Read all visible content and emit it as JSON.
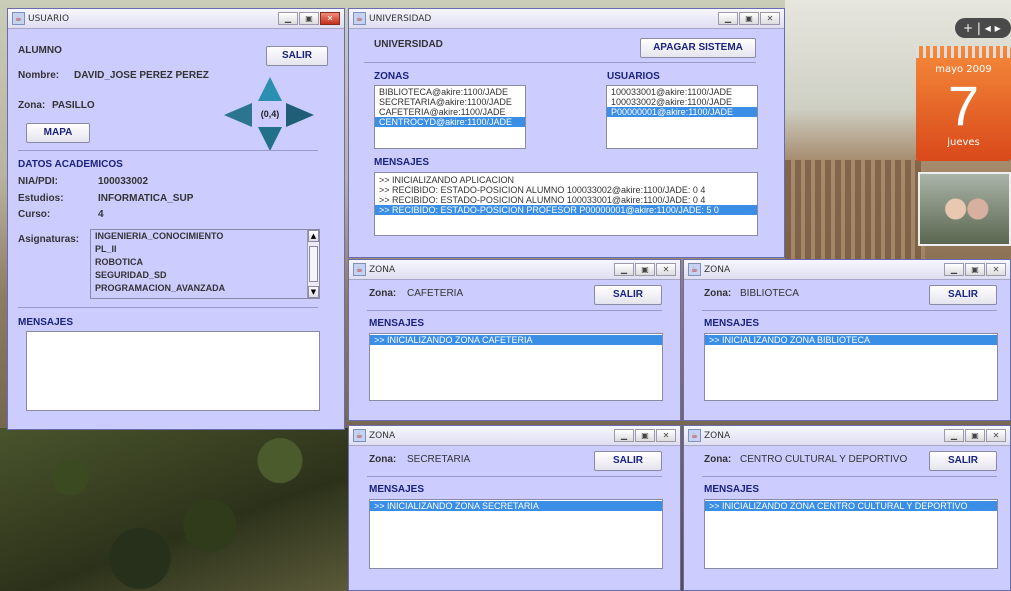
{
  "desktop": {
    "gadget_ctrl": "+ | ◂ ▸",
    "calendar": {
      "month": "mayo 2009",
      "day": "7",
      "weekday": "jueves"
    }
  },
  "usuario": {
    "title": "USUARIO",
    "alumno_label": "ALUMNO",
    "salir": "SALIR",
    "nombre_label": "Nombre:",
    "nombre_value": "DAVID_JOSE PEREZ PEREZ",
    "zona_label": "Zona:",
    "zona_value": "PASILLO",
    "coord": "(0,4)",
    "mapa": "MAPA",
    "datos_title": "DATOS ACADEMICOS",
    "nia_label": "NIA/PDI:",
    "nia_value": "100033002",
    "estudios_label": "Estudios:",
    "estudios_value": "INFORMATICA_SUP",
    "curso_label": "Curso:",
    "curso_value": "4",
    "asignaturas_label": "Asignaturas:",
    "asignaturas": [
      "INGENIERIA_CONOCIMIENTO",
      "PL_II",
      "ROBOTICA",
      "SEGURIDAD_SD",
      "PROGRAMACION_AVANZADA"
    ],
    "mensajes_label": "MENSAJES"
  },
  "universidad": {
    "title": "UNIVERSIDAD",
    "heading": "UNIVERSIDAD",
    "apagar": "APAGAR SISTEMA",
    "zonas_label": "ZONAS",
    "zonas": [
      "BIBLIOTECA@akire:1100/JADE",
      "SECRETARIA@akire:1100/JADE",
      "CAFETERIA@akire:1100/JADE",
      "CENTROCYD@akire:1100/JADE"
    ],
    "usuarios_label": "USUARIOS",
    "usuarios": [
      "100033001@akire:1100/JADE",
      "100033002@akire:1100/JADE",
      "P00000001@akire:1100/JADE"
    ],
    "mensajes_label": "MENSAJES",
    "mensajes": [
      ">> INICIALIZANDO APLICACION",
      ">> RECIBIDO: ESTADO-POSICION ALUMNO 100033002@akire:1100/JADE: 0 4",
      ">> RECIBIDO: ESTADO-POSICION ALUMNO 100033001@akire:1100/JADE: 0 4",
      ">> RECIBIDO: ESTADO-POSICION PROFESOR P00000001@akire:1100/JADE: 5 0"
    ]
  },
  "zonas": [
    {
      "title": "ZONA",
      "zona_label": "Zona:",
      "zona_value": "CAFETERIA",
      "salir": "SALIR",
      "mensajes_label": "MENSAJES",
      "mensaje": ">> INICIALIZANDO ZONA CAFETERIA"
    },
    {
      "title": "ZONA",
      "zona_label": "Zona:",
      "zona_value": "BIBLIOTECA",
      "salir": "SALIR",
      "mensajes_label": "MENSAJES",
      "mensaje": ">> INICIALIZANDO ZONA BIBLIOTECA"
    },
    {
      "title": "ZONA",
      "zona_label": "Zona:",
      "zona_value": "SECRETARIA",
      "salir": "SALIR",
      "mensajes_label": "MENSAJES",
      "mensaje": ">> INICIALIZANDO ZONA SECRETARIA"
    },
    {
      "title": "ZONA",
      "zona_label": "Zona:",
      "zona_value": "CENTRO CULTURAL Y DEPORTIVO",
      "salir": "SALIR",
      "mensajes_label": "MENSAJES",
      "mensaje": ">> INICIALIZANDO ZONA CENTRO CULTURAL Y DEPORTIVO"
    }
  ],
  "colors": {
    "window_bg": "#ccccff",
    "selection": "#3a8ee6",
    "label_blue": "#1a237e"
  }
}
